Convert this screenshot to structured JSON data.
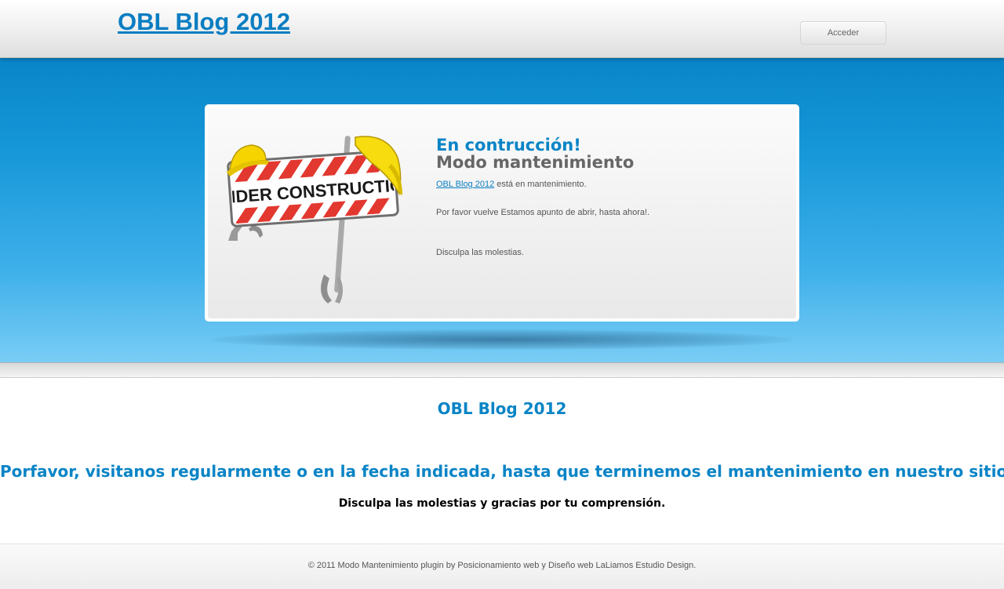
{
  "header": {
    "site_title": "OBL Blog 2012",
    "login_label": "Acceder"
  },
  "panel": {
    "image_sign_text": "UNDER CONSTRUCTION",
    "heading_primary": "En contrucción!",
    "heading_secondary": "Modo mantenimiento",
    "site_link": "OBL Blog 2012",
    "maintenance_suffix": " está en mantenimiento.",
    "return_message": "Por favor vuelve Estamos apunto de abrir, hasta ahora!.",
    "apology": "Disculpa las molestias."
  },
  "content": {
    "title": "OBL Blog 2012",
    "message": "Porfavor, visitanos regularmente o en la fecha indicada, hasta que terminemos el mantenimiento en nuestro sitio.",
    "apology": "Disculpa las molestias y gracias por tu comprensión."
  },
  "footer": {
    "credits": "© 2011 Modo Mantenimiento plugin by Posicionamiento web y Diseño web LaLiamos Estudio Design."
  },
  "colors": {
    "brand_blue": "#0a84c6",
    "hero_top": "#0885c8",
    "hero_bottom": "#79cdf5"
  }
}
